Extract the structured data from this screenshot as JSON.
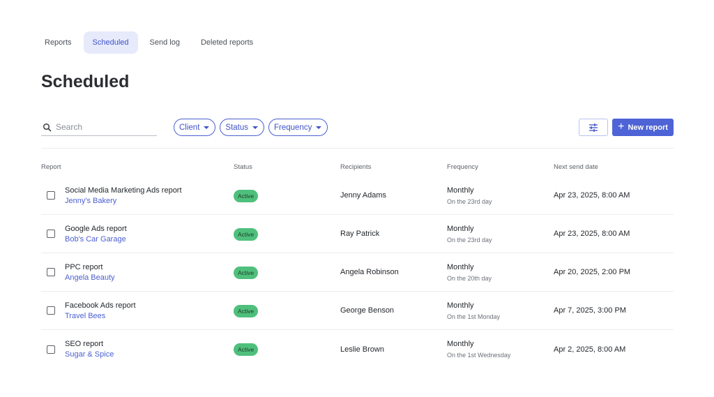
{
  "tabs": [
    {
      "label": "Reports",
      "active": false
    },
    {
      "label": "Scheduled",
      "active": true
    },
    {
      "label": "Send log",
      "active": false
    },
    {
      "label": "Deleted reports",
      "active": false
    }
  ],
  "page": {
    "title": "Scheduled"
  },
  "search": {
    "placeholder": "Search",
    "value": "",
    "icon": "search-icon"
  },
  "filters": [
    {
      "label": "Client"
    },
    {
      "label": "Status"
    },
    {
      "label": "Frequency"
    }
  ],
  "toolbar": {
    "settings_icon": "sliders-icon",
    "new_label": "New report",
    "new_icon": "plus-icon"
  },
  "colors": {
    "accent": "#4d63d6",
    "active_badge": "#4fc07c",
    "tab_active_bg": "#e6eafb"
  },
  "table": {
    "headers": {
      "report": "Report",
      "status": "Status",
      "recipients": "Recipients",
      "frequency": "Frequency",
      "next_send": "Next send date"
    },
    "rows": [
      {
        "name": "Social Media Marketing Ads report",
        "client": "Jenny's Bakery",
        "status": "Active",
        "recipient": "Jenny Adams",
        "frequency": "Monthly",
        "frequency_detail": "On the 23rd day",
        "next_send": "Apr 23, 2025, 8:00 AM"
      },
      {
        "name": "Google Ads report",
        "client": "Bob's Car Garage",
        "status": "Active",
        "recipient": "Ray Patrick",
        "frequency": "Monthly",
        "frequency_detail": "On the 23rd day",
        "next_send": "Apr 23, 2025, 8:00 AM"
      },
      {
        "name": "PPC report",
        "client": "Angela Beauty",
        "status": "Active",
        "recipient": "Angela Robinson",
        "frequency": "Monthly",
        "frequency_detail": "On the 20th day",
        "next_send": "Apr 20, 2025, 2:00 PM"
      },
      {
        "name": "Facebook Ads report",
        "client": "Travel Bees",
        "status": "Active",
        "recipient": "George Benson",
        "frequency": "Monthly",
        "frequency_detail": "On the 1st Monday",
        "next_send": "Apr 7, 2025, 3:00 PM"
      },
      {
        "name": "SEO report",
        "client": "Sugar & Spice",
        "status": "Active",
        "recipient": "Leslie Brown",
        "frequency": "Monthly",
        "frequency_detail": "On the 1st Wednesday",
        "next_send": "Apr 2, 2025, 8:00 AM"
      }
    ]
  }
}
